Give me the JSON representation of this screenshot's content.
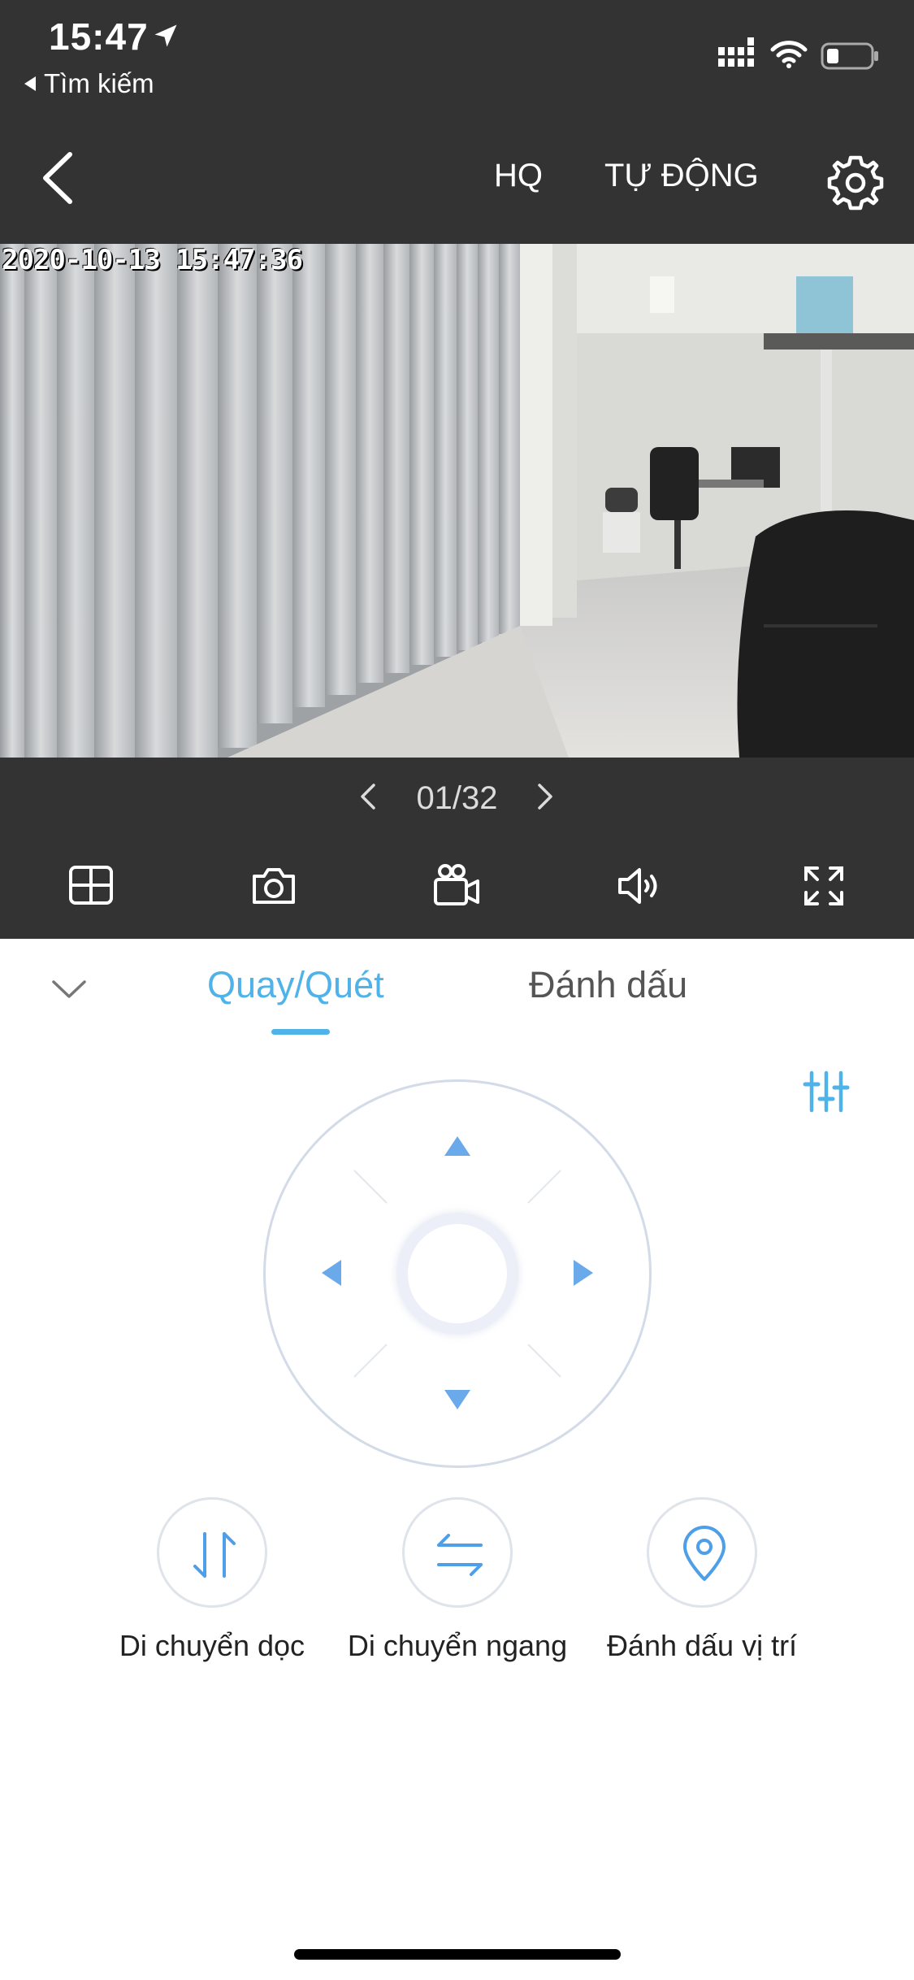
{
  "status_bar": {
    "time": "15:47",
    "back_app": "Tìm kiếm"
  },
  "nav": {
    "quality": "HQ",
    "mode": "TỰ ĐỘNG"
  },
  "video": {
    "timestamp": "2020-10-13 15:47:36"
  },
  "pager": {
    "text": "01/32"
  },
  "toolbar": {
    "icons": [
      "grid-layout-icon",
      "camera-icon",
      "video-record-icon",
      "speaker-icon",
      "fullscreen-icon"
    ]
  },
  "tabs": {
    "active": "Quay/Quét",
    "other": "Đánh dấu"
  },
  "actions": [
    {
      "label": "Di chuyển dọc",
      "icon": "vertical-arrows-icon"
    },
    {
      "label": "Di chuyển ngang",
      "icon": "horizontal-arrows-icon"
    },
    {
      "label": "Đánh dấu vị trí",
      "icon": "location-pin-icon"
    }
  ],
  "colors": {
    "accent": "#4fb2e8",
    "dark_bg": "#333333",
    "arrow": "#6aa9ea"
  }
}
